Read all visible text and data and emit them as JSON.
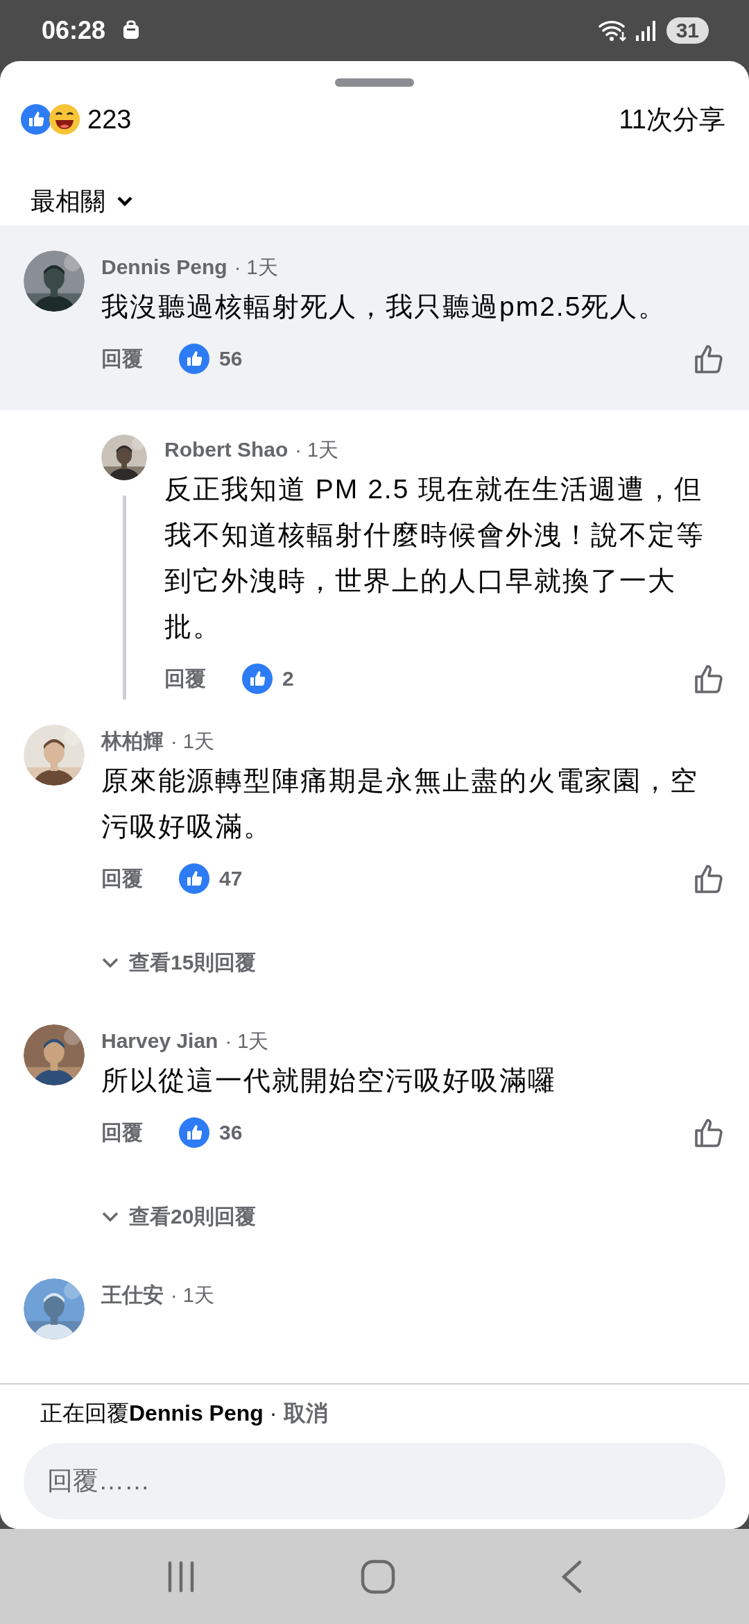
{
  "status_bar": {
    "time": "06:28",
    "battery": "31"
  },
  "post_stats": {
    "reactions": "223",
    "shares": "11次分享"
  },
  "sort": {
    "label": "最相關"
  },
  "comments": [
    {
      "author": "Dennis Peng",
      "time": "· 1天",
      "text": "我沒聽過核輻射死人，我只聽過pm2.5死人。",
      "reply_label": "回覆",
      "likes": "56",
      "highlighted": true,
      "replies": [
        {
          "author": "Robert Shao",
          "time": "· 1天",
          "text": "反正我知道 PM 2.5 現在就在生活週遭，但我不知道核輻射什麼時候會外洩！說不定等到它外洩時，世界上的人口早就換了一大批。",
          "reply_label": "回覆",
          "likes": "2",
          "highlighted": false
        }
      ]
    },
    {
      "author": "林柏輝",
      "time": "· 1天",
      "text": "原來能源轉型陣痛期是永無止盡的火電家園，空污吸好吸滿。",
      "reply_label": "回覆",
      "likes": "47",
      "highlighted": false,
      "view_replies": "查看15則回覆"
    },
    {
      "author": "Harvey Jian",
      "time": "· 1天",
      "text": "所以從這一代就開始空污吸好吸滿囉",
      "reply_label": "回覆",
      "likes": "36",
      "highlighted": false,
      "view_replies": "查看20則回覆"
    },
    {
      "author": "王仕安",
      "time": "· 1天",
      "highlighted": false
    }
  ],
  "composer": {
    "replying_to": "正在回覆**Dennis Peng** ·",
    "cancel": "取消",
    "placeholder": "回覆……"
  }
}
